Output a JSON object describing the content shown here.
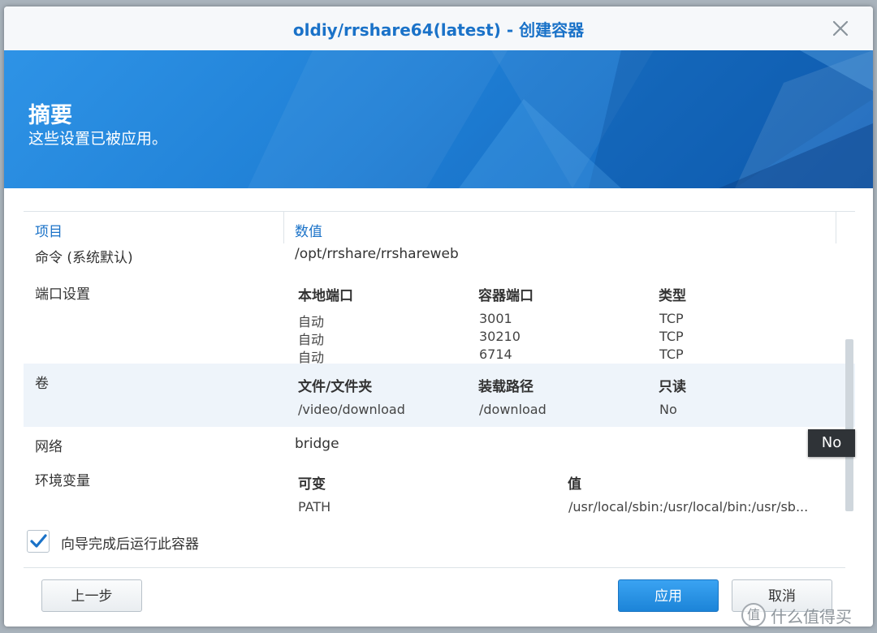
{
  "window": {
    "title": "oldiy/rrshare64(latest) - 创建容器"
  },
  "banner": {
    "title": "摘要",
    "subtitle": "这些设置已被应用。"
  },
  "table": {
    "columns": [
      "项目",
      "数值"
    ],
    "command": {
      "label": "命令 (系统默认)",
      "value": "/opt/rrshare/rrshareweb"
    },
    "ports": {
      "label": "端口设置",
      "headers": [
        "本地端口",
        "容器端口",
        "类型"
      ],
      "rows": [
        [
          "自动",
          "3001",
          "TCP"
        ],
        [
          "自动",
          "30210",
          "TCP"
        ],
        [
          "自动",
          "6714",
          "TCP"
        ]
      ]
    },
    "volumes": {
      "label": "卷",
      "headers": [
        "文件/文件夹",
        "装载路径",
        "只读"
      ],
      "rows": [
        [
          "/video/download",
          "/download",
          "No"
        ]
      ]
    },
    "network": {
      "label": "网络",
      "value": "bridge"
    },
    "env": {
      "label": "环境变量",
      "headers": [
        "可变",
        "值"
      ],
      "rows": [
        [
          "PATH",
          "/usr/local/sbin:/usr/local/bin:/usr/sb..."
        ]
      ]
    }
  },
  "tooltip": {
    "text": "No"
  },
  "checkbox": {
    "label": "向导完成后运行此容器",
    "checked": true
  },
  "buttons": {
    "back": "上一步",
    "apply": "应用",
    "cancel": "取消"
  },
  "watermark": {
    "icon_text": "值",
    "text": "什么值得买"
  },
  "colors": {
    "accent": "#1a72c8",
    "banner": "#1f7fd5",
    "primary_button": "#1c84d8"
  }
}
